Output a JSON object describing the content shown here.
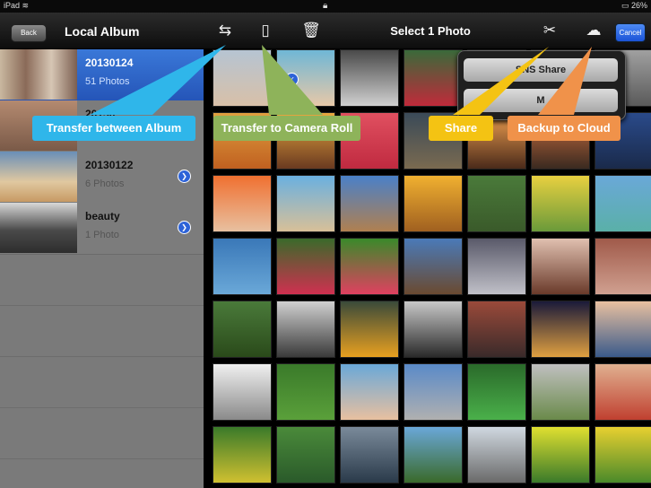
{
  "status_bar": {
    "device": "iPad",
    "wifi_icon": "wifi-icon",
    "lock_icon": "lock-icon",
    "battery": "26%"
  },
  "header": {
    "back_label": "Back",
    "left_title": "Local Album",
    "title": "Select 1 Photo",
    "cancel_label": "Cancel",
    "toolbar_icons": [
      "transfer-album-icon",
      "camera-roll-icon",
      "trash-icon",
      "share-icon",
      "cloud-icon"
    ]
  },
  "albums": [
    {
      "name": "20130124",
      "count": "51 Photos",
      "selected": true
    },
    {
      "name": "20130",
      "count": "",
      "selected": false
    },
    {
      "name": "20130122",
      "count": "6 Photos",
      "selected": false
    },
    {
      "name": "beauty",
      "count": "1 Photo",
      "selected": false
    }
  ],
  "popover": {
    "items": [
      "SNS Share",
      "M"
    ]
  },
  "callouts": {
    "transfer_album": "Transfer between Album",
    "camera_roll": "Transfer to Camera Roll",
    "share": "Share",
    "backup": "Backup to Cloud"
  },
  "colors": {
    "transfer_album": "#2fb6ea",
    "camera_roll": "#8eb35a",
    "share": "#f4c313",
    "backup": "#f0924a",
    "cancel": "#2a63dc"
  }
}
